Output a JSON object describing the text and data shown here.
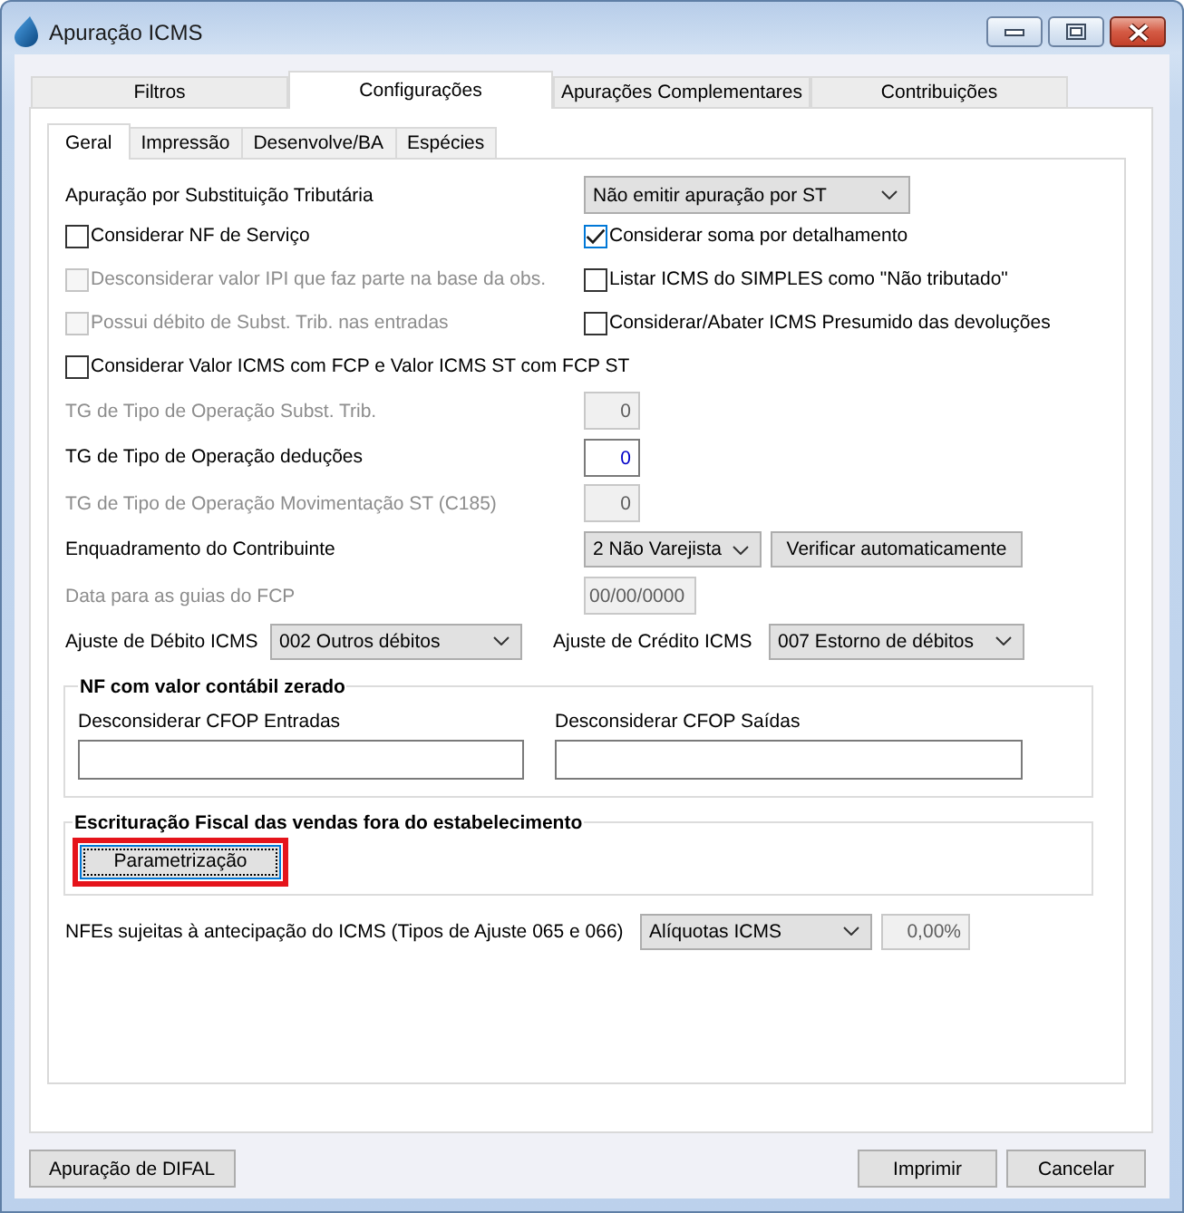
{
  "window": {
    "title": "Apuração ICMS"
  },
  "tabs": [
    {
      "label": "Filtros",
      "selected": false
    },
    {
      "label": "Configurações",
      "selected": true
    },
    {
      "label": "Apurações Complementares",
      "selected": false
    },
    {
      "label": "Contribuições",
      "selected": false
    }
  ],
  "subtabs": [
    {
      "label": "Geral",
      "selected": true
    },
    {
      "label": "Impressão",
      "selected": false
    },
    {
      "label": "Desenvolve/BA",
      "selected": false
    },
    {
      "label": "Espécies",
      "selected": false
    }
  ],
  "st_calculation": {
    "label": "Apuração por Substituição Tributária",
    "value": "Não emitir apuração por ST"
  },
  "options": [
    {
      "label": "Considerar NF de Serviço",
      "checked": false,
      "disabled": false
    },
    {
      "label": "Considerar soma por detalhamento",
      "checked": true,
      "disabled": false
    },
    {
      "label": "Desconsiderar valor IPI que faz parte na base da obs.",
      "checked": false,
      "disabled": true
    },
    {
      "label": "Listar ICMS do SIMPLES como \"Não tributado\"",
      "checked": false,
      "disabled": false
    },
    {
      "label": "Possui débito de Subst. Trib. nas entradas",
      "checked": false,
      "disabled": true
    },
    {
      "label": "Considerar/Abater ICMS Presumido das devoluções",
      "checked": false,
      "disabled": false
    },
    {
      "label": "Considerar Valor ICMS com FCP e Valor ICMS ST com FCP ST",
      "checked": false,
      "disabled": false
    }
  ],
  "fields": [
    {
      "kind": "number",
      "label": "TG de Tipo de Operação Subst. Trib.",
      "value": "0",
      "disabled": true
    },
    {
      "kind": "number",
      "label": "TG de Tipo de Operação deduções",
      "value": "0",
      "disabled": false
    },
    {
      "kind": "number",
      "label": "TG de Tipo de Operação Movimentação ST (C185)",
      "value": "0",
      "disabled": true
    },
    {
      "kind": "select",
      "label": "Enquadramento do Contribuinte",
      "value": "2 Não Varejista",
      "button": "Verificar automaticamente",
      "disabled": false
    },
    {
      "kind": "date",
      "label": "Data para as guias do FCP",
      "value": "00/00/0000",
      "disabled": true
    }
  ],
  "adjustments": [
    {
      "label": "Ajuste de Débito ICMS",
      "value": "002 Outros débitos"
    },
    {
      "label": "Ajuste de Crédito ICMS",
      "value": "007 Estorno de débitos"
    }
  ],
  "zero_value_group": {
    "title": "NF com valor contábil zerado",
    "fields": [
      {
        "label": "Desconsiderar CFOP Entradas"
      },
      {
        "label": "Desconsiderar CFOP Saídas"
      }
    ]
  },
  "off_site_group": {
    "title": "Escrituração Fiscal das vendas fora do estabelecimento",
    "button": {
      "label": "Parametrização",
      "focused": true,
      "highlighted": true
    }
  },
  "anticipation": {
    "label": "NFEs sujeitas à antecipação do ICMS (Tipos de Ajuste 065 e 066)",
    "select": "Alíquotas ICMS",
    "rate": {
      "value": "0,00%",
      "disabled": true
    }
  },
  "footer": {
    "left_buttons": [
      "Apuração de DIFAL"
    ],
    "right_buttons": [
      "Imprimir",
      "Cancelar"
    ]
  }
}
